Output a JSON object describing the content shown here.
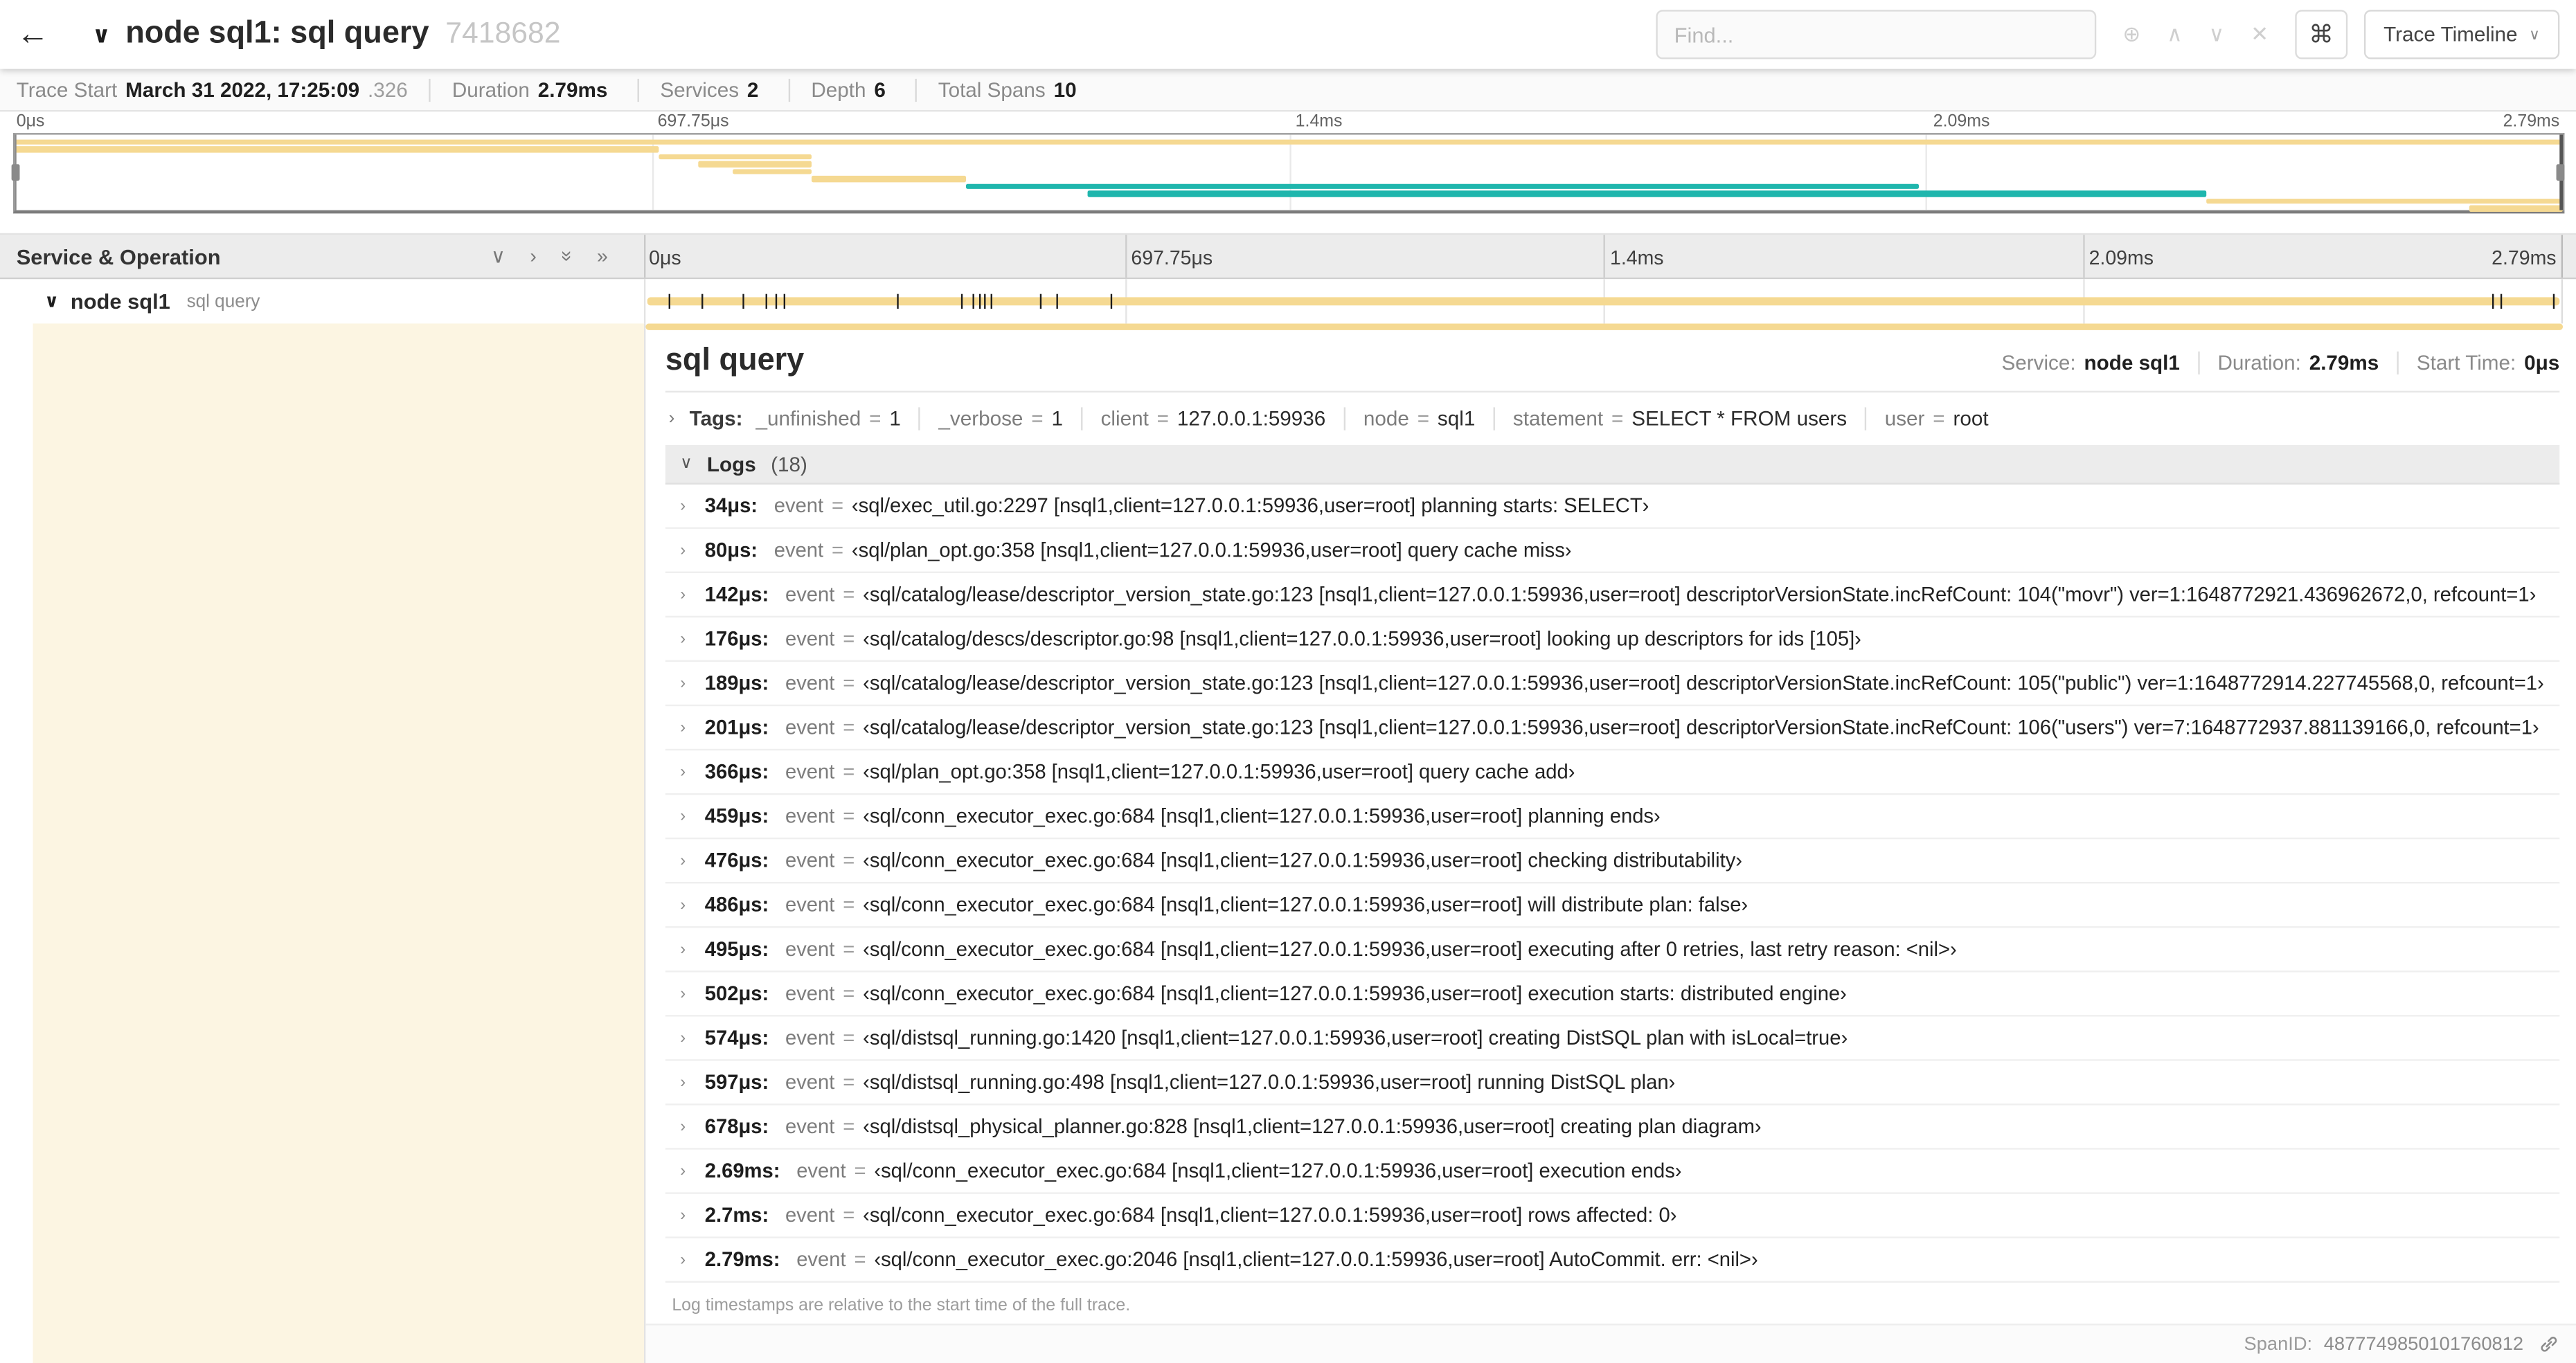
{
  "colors": {
    "tan": "#f5d992",
    "teal": "#1fb6ad"
  },
  "icons": {
    "back": "←",
    "chevron_down": "∨",
    "chevron_right": "›",
    "double_chevron": "»",
    "circle_plus": "⊕",
    "up": "∧",
    "down": "∨",
    "close": "✕",
    "command": "⌘"
  },
  "header": {
    "title": "node sql1: sql query",
    "trace_id": "7418682",
    "find_placeholder": "Find...",
    "view_dropdown": "Trace Timeline"
  },
  "summary": {
    "items": [
      {
        "label": "Trace Start",
        "value": "March 31 2022, 17:25:09",
        "suffix": ".326"
      },
      {
        "label": "Duration",
        "value": "2.79ms"
      },
      {
        "label": "Services",
        "value": "2"
      },
      {
        "label": "Depth",
        "value": "6"
      },
      {
        "label": "Total Spans",
        "value": "10"
      }
    ]
  },
  "minimap": {
    "ticks": [
      {
        "label": "0μs",
        "pct": 0
      },
      {
        "label": "697.75μs",
        "pct": 25
      },
      {
        "label": "1.4ms",
        "pct": 50
      },
      {
        "label": "2.09ms",
        "pct": 75
      },
      {
        "label": "2.79ms",
        "pct": 100
      }
    ],
    "spans": [
      {
        "row": 0,
        "start": 0,
        "end": 100,
        "color": "tan"
      },
      {
        "row": 1,
        "start": 0,
        "end": 25.3,
        "color": "tan"
      },
      {
        "row": 2,
        "start": 25.3,
        "end": 31.3,
        "color": "tan"
      },
      {
        "row": 3,
        "start": 26.8,
        "end": 31.3,
        "color": "tan"
      },
      {
        "row": 4,
        "start": 28.2,
        "end": 31.3,
        "color": "tan"
      },
      {
        "row": 5,
        "start": 31.3,
        "end": 37.3,
        "color": "tan"
      },
      {
        "row": 6,
        "start": 37.3,
        "end": 74.7,
        "color": "teal"
      },
      {
        "row": 7,
        "start": 42.1,
        "end": 86.0,
        "color": "teal"
      },
      {
        "row": 8,
        "start": 86.0,
        "end": 100,
        "color": "tan"
      },
      {
        "row": 9,
        "start": 96.3,
        "end": 100,
        "color": "tan"
      }
    ]
  },
  "timeline": {
    "left_header": "Service & Operation",
    "ticks": [
      {
        "label": "0μs",
        "pct": 0
      },
      {
        "label": "697.75μs",
        "pct": 25
      },
      {
        "label": "1.4ms",
        "pct": 50
      },
      {
        "label": "2.09ms",
        "pct": 75
      },
      {
        "label": "2.79ms",
        "pct": 100
      }
    ],
    "row": {
      "service": "node sql1",
      "operation": "sql query"
    },
    "event_ticks_pct": [
      1.2,
      2.9,
      5.1,
      6.3,
      6.8,
      7.2,
      13.1,
      16.5,
      17.1,
      17.4,
      17.7,
      18.0,
      20.6,
      21.4,
      24.3,
      96.4,
      96.8,
      99.6
    ]
  },
  "detail": {
    "title": "sql query",
    "eq": "=",
    "meta": [
      {
        "label": "Service:",
        "value": "node sql1"
      },
      {
        "label": "Duration:",
        "value": "2.79ms"
      },
      {
        "label": "Start Time:",
        "value": "0μs"
      }
    ],
    "tags_label": "Tags:",
    "tags": [
      {
        "key": "_unfinished",
        "value": "1"
      },
      {
        "key": "_verbose",
        "value": "1"
      },
      {
        "key": "client",
        "value": "127.0.0.1:59936"
      },
      {
        "key": "node",
        "value": "sql1"
      },
      {
        "key": "statement",
        "value": "SELECT * FROM users"
      },
      {
        "key": "user",
        "value": "root"
      }
    ],
    "logs_title": "Logs",
    "logs_count": "(18)",
    "logs": [
      {
        "time": "34μs:",
        "field": "event",
        "value": "‹sql/exec_util.go:2297 [nsql1,client=127.0.0.1:59936,user=root] planning starts: SELECT›"
      },
      {
        "time": "80μs:",
        "field": "event",
        "value": "‹sql/plan_opt.go:358 [nsql1,client=127.0.0.1:59936,user=root] query cache miss›"
      },
      {
        "time": "142μs:",
        "field": "event",
        "value": "‹sql/catalog/lease/descriptor_version_state.go:123 [nsql1,client=127.0.0.1:59936,user=root] descriptorVersionState.incRefCount: 104(\"movr\") ver=1:1648772921.436962672,0, refcount=1›"
      },
      {
        "time": "176μs:",
        "field": "event",
        "value": "‹sql/catalog/descs/descriptor.go:98 [nsql1,client=127.0.0.1:59936,user=root] looking up descriptors for ids [105]›"
      },
      {
        "time": "189μs:",
        "field": "event",
        "value": "‹sql/catalog/lease/descriptor_version_state.go:123 [nsql1,client=127.0.0.1:59936,user=root] descriptorVersionState.incRefCount: 105(\"public\") ver=1:1648772914.227745568,0, refcount=1›"
      },
      {
        "time": "201μs:",
        "field": "event",
        "value": "‹sql/catalog/lease/descriptor_version_state.go:123 [nsql1,client=127.0.0.1:59936,user=root] descriptorVersionState.incRefCount: 106(\"users\") ver=7:1648772937.881139166,0, refcount=1›"
      },
      {
        "time": "366μs:",
        "field": "event",
        "value": "‹sql/plan_opt.go:358 [nsql1,client=127.0.0.1:59936,user=root] query cache add›"
      },
      {
        "time": "459μs:",
        "field": "event",
        "value": "‹sql/conn_executor_exec.go:684 [nsql1,client=127.0.0.1:59936,user=root] planning ends›"
      },
      {
        "time": "476μs:",
        "field": "event",
        "value": "‹sql/conn_executor_exec.go:684 [nsql1,client=127.0.0.1:59936,user=root] checking distributability›"
      },
      {
        "time": "486μs:",
        "field": "event",
        "value": "‹sql/conn_executor_exec.go:684 [nsql1,client=127.0.0.1:59936,user=root] will distribute plan: false›"
      },
      {
        "time": "495μs:",
        "field": "event",
        "value": "‹sql/conn_executor_exec.go:684 [nsql1,client=127.0.0.1:59936,user=root] executing after 0 retries, last retry reason: <nil>›"
      },
      {
        "time": "502μs:",
        "field": "event",
        "value": "‹sql/conn_executor_exec.go:684 [nsql1,client=127.0.0.1:59936,user=root] execution starts: distributed engine›"
      },
      {
        "time": "574μs:",
        "field": "event",
        "value": "‹sql/distsql_running.go:1420 [nsql1,client=127.0.0.1:59936,user=root] creating DistSQL plan with isLocal=true›"
      },
      {
        "time": "597μs:",
        "field": "event",
        "value": "‹sql/distsql_running.go:498 [nsql1,client=127.0.0.1:59936,user=root] running DistSQL plan›"
      },
      {
        "time": "678μs:",
        "field": "event",
        "value": "‹sql/distsql_physical_planner.go:828 [nsql1,client=127.0.0.1:59936,user=root] creating plan diagram›"
      },
      {
        "time": "2.69ms:",
        "field": "event",
        "value": "‹sql/conn_executor_exec.go:684 [nsql1,client=127.0.0.1:59936,user=root] execution ends›"
      },
      {
        "time": "2.7ms:",
        "field": "event",
        "value": "‹sql/conn_executor_exec.go:684 [nsql1,client=127.0.0.1:59936,user=root] rows affected: 0›"
      },
      {
        "time": "2.79ms:",
        "field": "event",
        "value": "‹sql/conn_executor_exec.go:2046 [nsql1,client=127.0.0.1:59936,user=root] AutoCommit. err: <nil>›"
      }
    ],
    "logs_note": "Log timestamps are relative to the start time of the full trace.",
    "span_id_label": "SpanID:",
    "span_id": "4877749850101760812"
  }
}
